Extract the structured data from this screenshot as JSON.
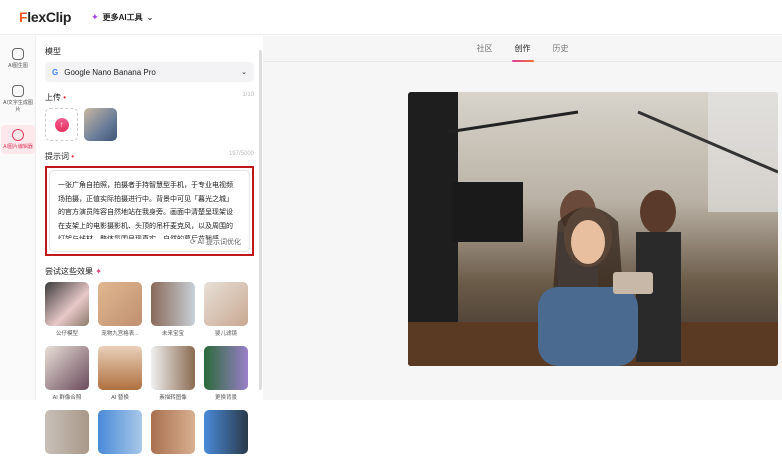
{
  "header": {
    "logo_a": "F",
    "logo_b": "lexClip",
    "tools": "更多AI工具"
  },
  "sidebar": [
    {
      "label": "AI图生图"
    },
    {
      "label": "AI文字生成图片"
    },
    {
      "label": "AI图片编辑器"
    }
  ],
  "panel": {
    "model_label": "模型",
    "model_value": "Google Nano Banana Pro",
    "upload_label": "上传",
    "upload_count": "1/10",
    "prompt_label": "提示词",
    "prompt_count": "197/5000",
    "prompt_text": "一张广角自拍照，拍摄者手持智慧型手机，于专业电视频场拍摄，正值实际拍摄进行中。背景中可见「暮光之城」的官方演员阵容自然地站在我身旁。画面中清楚呈现架设在支架上的电影摄影机、头顶的吊杆麦克风，以及周围的灯架与线材，整体氛围呈现真实、自然的幕后花絮感……",
    "optimize": "AI 提示词优化",
    "try_label": "尝试这些效果",
    "effects": [
      {
        "label": "公仔模型",
        "c": "linear-gradient(135deg,#3a3a3a,#e8c8c8 60%,#8a7a6a)"
      },
      {
        "label": "宠物九宫格表...",
        "c": "linear-gradient(135deg,#e0b890,#c09070)"
      },
      {
        "label": "未来宝宝",
        "c": "linear-gradient(90deg,#8a6a5a,#c8d0d8)"
      },
      {
        "label": "婴儿滤镜",
        "c": "linear-gradient(135deg,#e8e0d8,#c8a890)"
      },
      {
        "label": "AI 群像合照",
        "c": "linear-gradient(135deg,#e8e0d8,#6a4a5a)"
      },
      {
        "label": "AI 替换",
        "c": "linear-gradient(180deg,#e8d0b8,#b07040)"
      },
      {
        "label": "素描转图像",
        "c": "linear-gradient(90deg,#f0f0f0,#8a6a50)"
      },
      {
        "label": "更换背景",
        "c": "linear-gradient(90deg,#2a6a3a,#9a80c8)"
      },
      {
        "label": "",
        "c": "linear-gradient(90deg,#c8c0b8,#a89888)"
      },
      {
        "label": "",
        "c": "linear-gradient(90deg,#4a8ad8,#a8c8e8)"
      },
      {
        "label": "",
        "c": "linear-gradient(90deg,#a87050,#d8b090)"
      },
      {
        "label": "",
        "c": "linear-gradient(90deg,#4a8ad8,#2a3a4a)"
      }
    ]
  },
  "main": {
    "tabs": [
      {
        "label": "社区"
      },
      {
        "label": "创作",
        "active": true
      },
      {
        "label": "历史"
      }
    ]
  }
}
